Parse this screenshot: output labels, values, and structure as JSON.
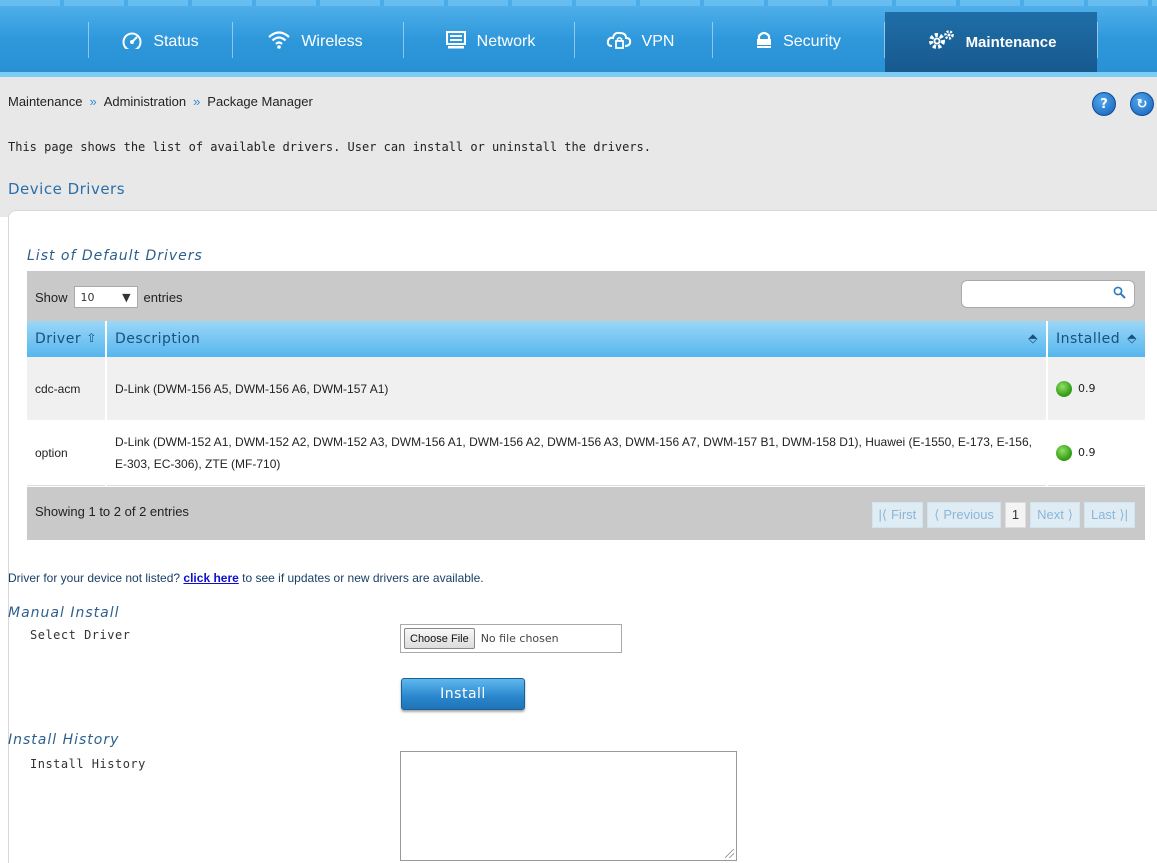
{
  "nav": {
    "items": [
      {
        "label": "Status",
        "icon": "gauge-icon"
      },
      {
        "label": "Wireless",
        "icon": "wifi-icon"
      },
      {
        "label": "Network",
        "icon": "monitor-icon"
      },
      {
        "label": "VPN",
        "icon": "cloud-lock-icon"
      },
      {
        "label": "Security",
        "icon": "lock-icon"
      },
      {
        "label": "Maintenance",
        "icon": "gears-icon",
        "active": true
      }
    ]
  },
  "breadcrumb": {
    "items": [
      "Maintenance",
      "Administration",
      "Package Manager"
    ],
    "separator": "»"
  },
  "header_icons": {
    "help": "?",
    "logout": "↻"
  },
  "page": {
    "description": "This page shows the list of available drivers. User can install or uninstall the drivers.",
    "section_title": "Device Drivers"
  },
  "drivers_table": {
    "title": "List of Default Drivers",
    "show_label": "Show",
    "show_value": "10",
    "entries_label": "entries",
    "search_value": "",
    "columns": [
      "Driver",
      "Description",
      "Installed"
    ],
    "rows": [
      {
        "driver": "cdc-acm",
        "description": "D-Link (DWM-156 A5, DWM-156 A6, DWM-157 A1)",
        "installed": "0.9"
      },
      {
        "driver": "option",
        "description": "D-Link (DWM-152 A1, DWM-152 A2, DWM-152 A3, DWM-156 A1, DWM-156 A2, DWM-156 A3, DWM-156 A7, DWM-157 B1, DWM-158 D1), Huawei (E-1550, E-173, E-156, E-303, EC-306), ZTE (MF-710)",
        "installed": "0.9"
      }
    ],
    "info": "Showing 1 to 2 of 2 entries",
    "pager": {
      "first": "First",
      "previous": "Previous",
      "current": "1",
      "next": "Next",
      "last": "Last"
    }
  },
  "not_listed": {
    "before": "Driver for your device not listed?",
    "link": "click here",
    "after": "to see if updates or new drivers are available."
  },
  "manual_install": {
    "title": "Manual Install",
    "select_label": "Select Driver",
    "file_button": "Choose File",
    "file_status": "No file chosen",
    "install_button": "Install"
  },
  "install_history": {
    "title": "Install History",
    "label": "Install History",
    "value": ""
  },
  "colors": {
    "nav_blue": "#2e98db",
    "accent": "#2a6fa8",
    "status_green": "#3aa21a"
  }
}
